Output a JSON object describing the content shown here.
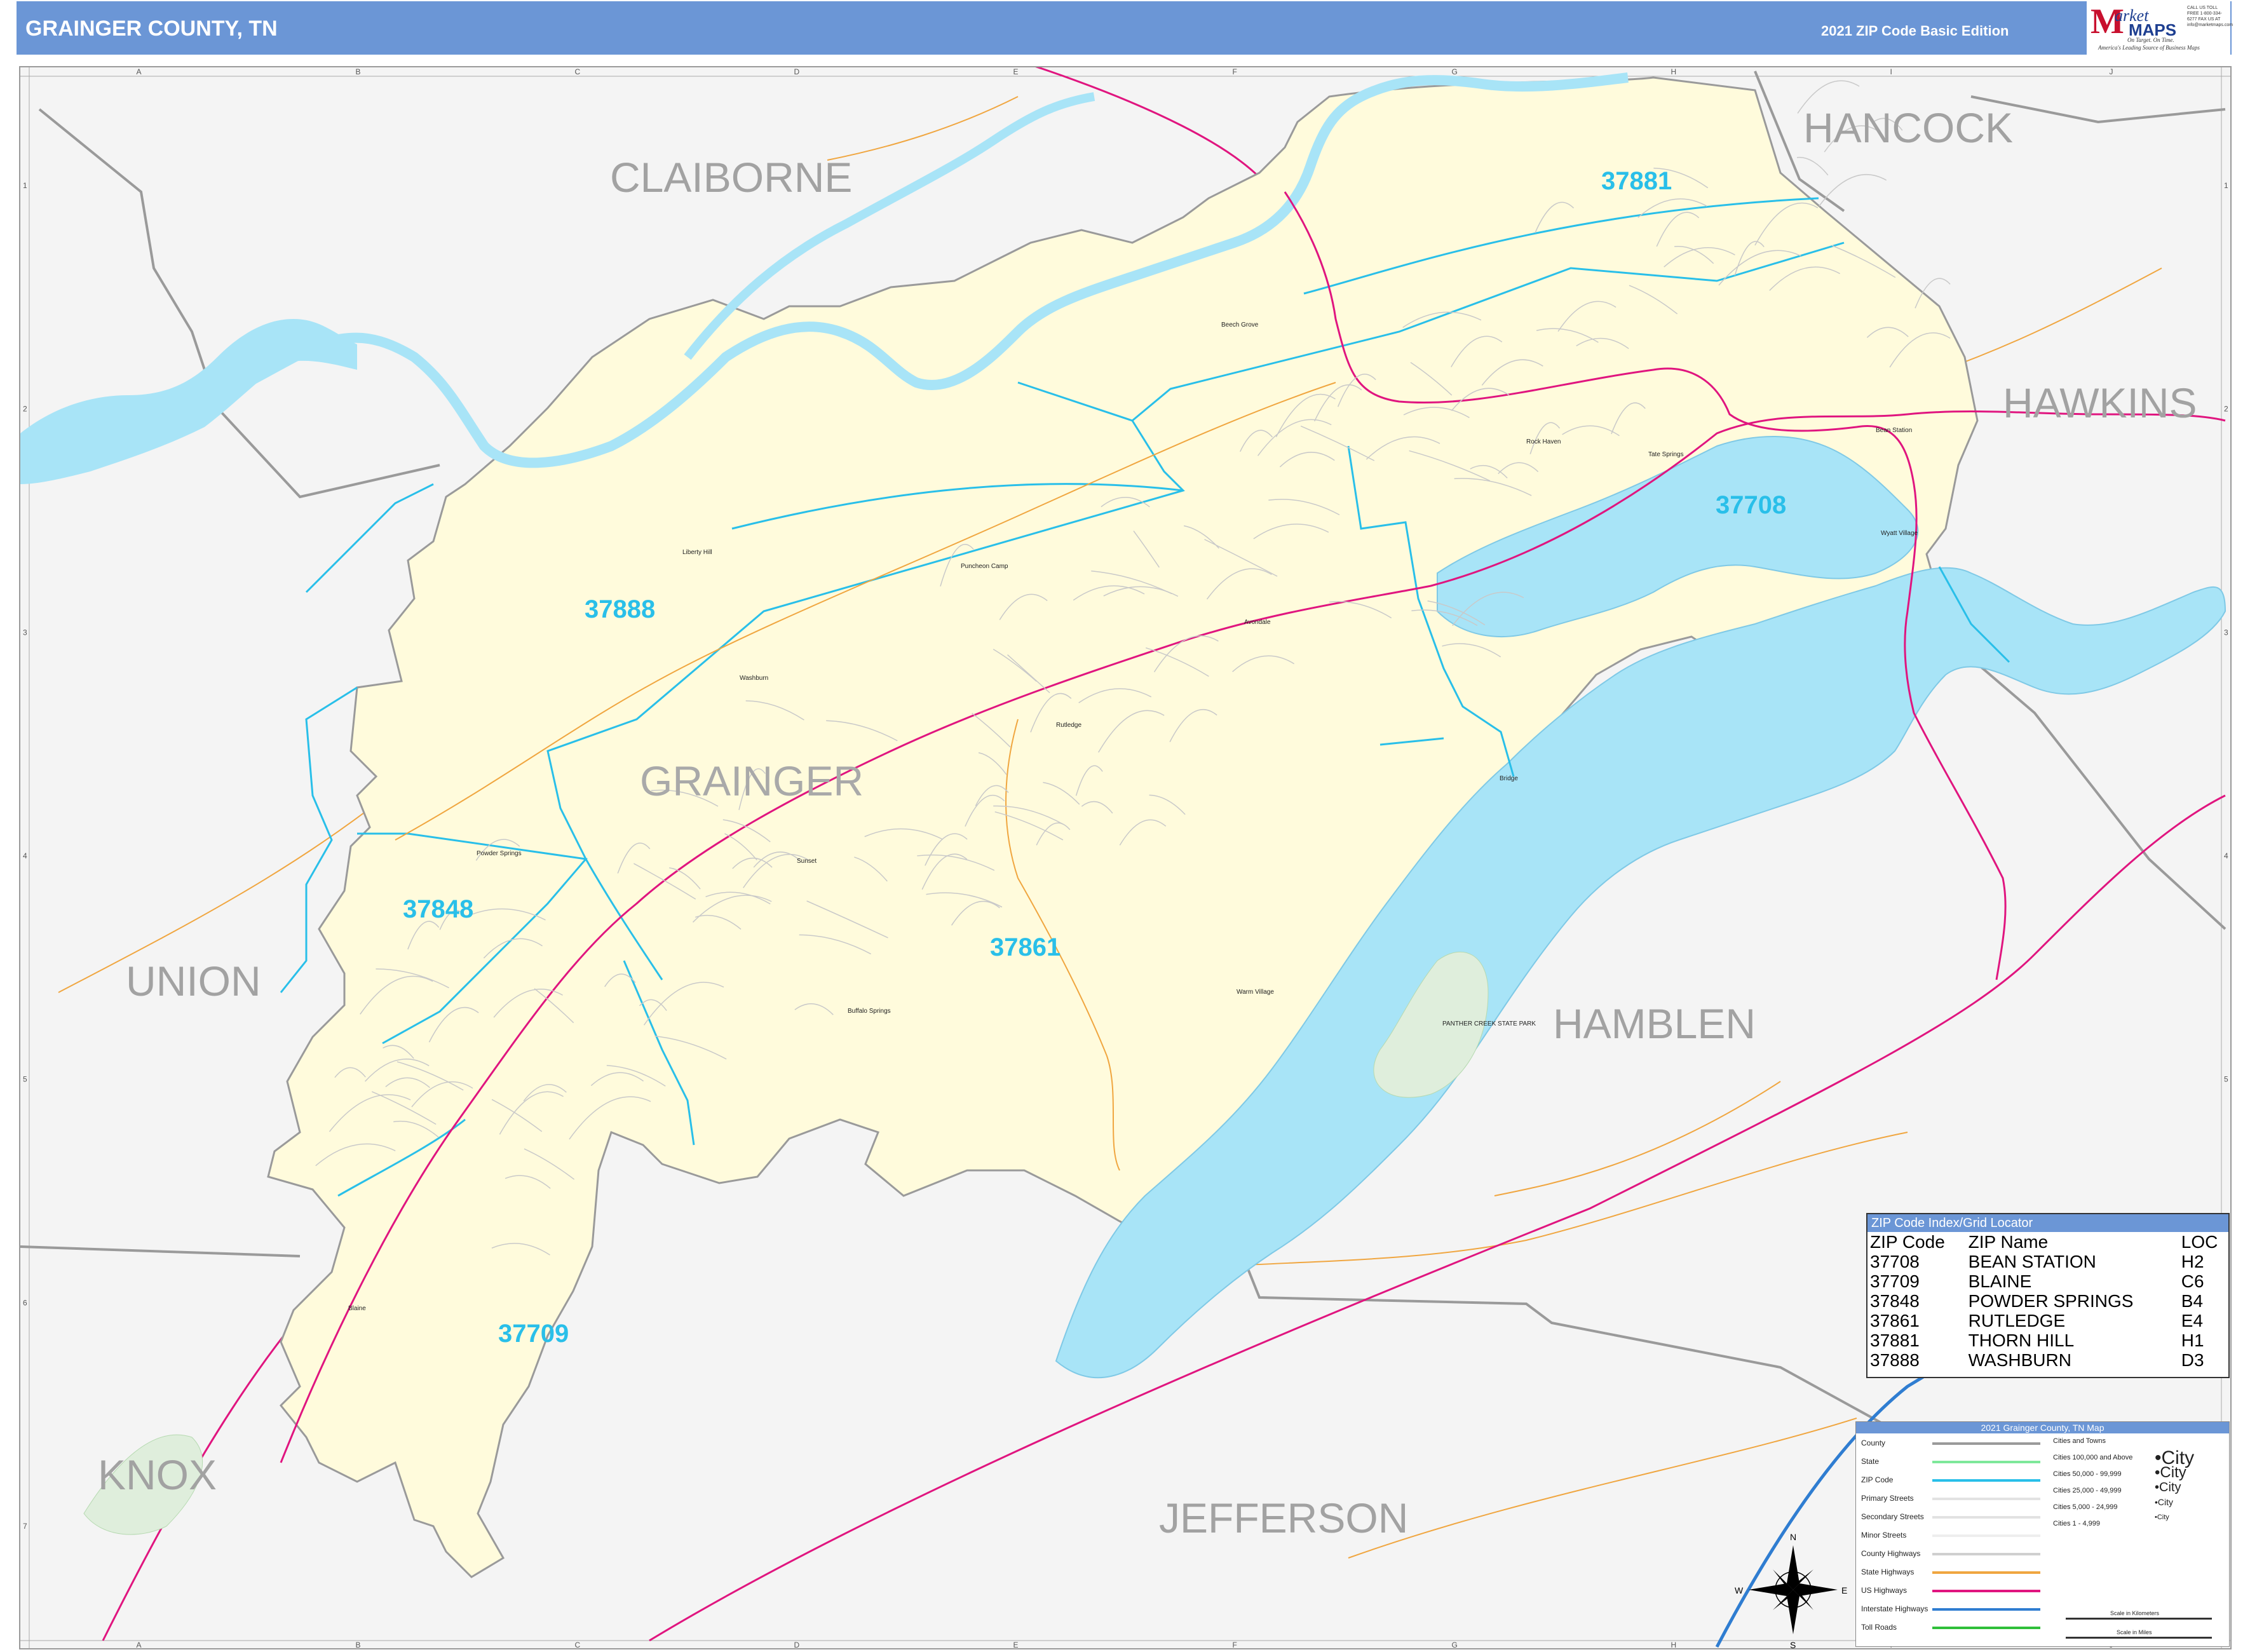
{
  "header": {
    "title": "GRAINGER COUNTY, TN",
    "edition": "2021 ZIP Code Basic Edition"
  },
  "logo": {
    "initial": "M",
    "word1": "arket",
    "word2": "MAPS",
    "tagline1": "On Target. On Time.",
    "tagline2": "America's Leading Source of Business Maps",
    "contact": "CALL US TOLL FREE 1-800-334-6277 FAX US AT info@marketmaps.com"
  },
  "map": {
    "grid_columns": [
      "A",
      "B",
      "C",
      "D",
      "E",
      "F",
      "G",
      "H",
      "I",
      "J"
    ],
    "grid_rows": [
      "1",
      "2",
      "3",
      "4",
      "5",
      "6",
      "7"
    ],
    "counties": {
      "claiborne": "CLAIBORNE",
      "hancock": "HANCOCK",
      "hawkins": "HAWKINS",
      "grainger": "GRAINGER",
      "union": "UNION",
      "hamblen": "HAMBLEN",
      "knox": "KNOX",
      "jefferson": "JEFFERSON"
    },
    "zips": {
      "z37881": "37881",
      "z37708": "37708",
      "z37888": "37888",
      "z37848": "37848",
      "z37861": "37861",
      "z37709": "37709"
    },
    "towns": {
      "beech_grove": "Beech Grove",
      "rock_haven": "Rock Haven",
      "tate_springs": "Tate Springs",
      "bean_station": "Bean Station",
      "liberty_hill": "Liberty Hill",
      "puncheon_camp": "Puncheon Camp",
      "avondale": "Avondale",
      "washburn": "Washburn",
      "rutledge": "Rutledge",
      "bridge": "Bridge",
      "powder_springs": "Powder Springs",
      "sunset": "Sunset",
      "buffalo_springs": "Buffalo Springs",
      "blaine": "Blaine",
      "warm_village": "Warm Village",
      "wyatt_village": "Wyatt Village",
      "panther_creek": "PANTHER CREEK STATE PARK"
    },
    "colors": {
      "county_fill": "#fffbdc",
      "water": "#a8e4f7",
      "zip_boundary": "#29bfe9",
      "us_highway": "#e0157f",
      "state_highway": "#f0a640",
      "interstate": "#2f7dd1",
      "county_line": "#9a9a9a"
    }
  },
  "zip_index": {
    "title": "ZIP Code Index/Grid Locator",
    "columns": [
      "ZIP Code",
      "ZIP Name",
      "LOC"
    ],
    "rows": [
      [
        "37708",
        "BEAN STATION",
        "H2"
      ],
      [
        "37709",
        "BLAINE",
        "C6"
      ],
      [
        "37848",
        "POWDER SPRINGS",
        "B4"
      ],
      [
        "37861",
        "RUTLEDGE",
        "E4"
      ],
      [
        "37881",
        "THORN HILL",
        "H1"
      ],
      [
        "37888",
        "WASHBURN",
        "D3"
      ]
    ]
  },
  "legend": {
    "title": "2021 Grainger County, TN Map",
    "items": [
      "County",
      "State",
      "ZIP Code",
      "Primary Streets",
      "Secondary Streets",
      "Minor Streets",
      "County Highways",
      "State Highways",
      "US Highways",
      "Interstate Highways",
      "Toll Roads"
    ],
    "cities_title": "Cities and Towns",
    "city_classes": [
      "Cities 100,000 and Above",
      "Cities 50,000 - 99,999",
      "Cities 25,000 - 49,999",
      "Cities 5,000 - 24,999",
      "Cities 1 - 4,999"
    ],
    "city_sample": "City",
    "scale_km": "Scale in Kilometers",
    "scale_mi": "Scale in Miles"
  },
  "compass": {
    "n": "N",
    "s": "S",
    "e": "E",
    "w": "W"
  }
}
